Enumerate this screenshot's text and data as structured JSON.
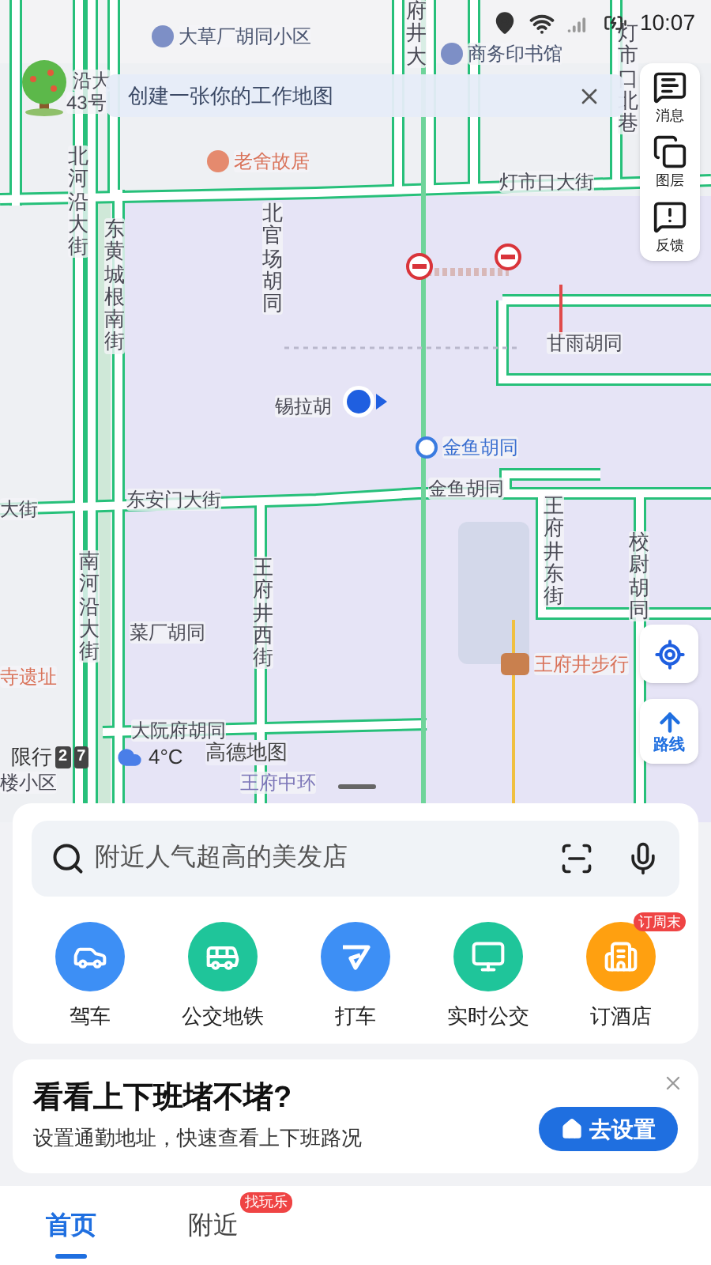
{
  "status_bar": {
    "time": "10:07"
  },
  "banner": {
    "text": "创建一张你的工作地图"
  },
  "map": {
    "labels": [
      {
        "text": "大草厂胡同小区",
        "kind": "poi",
        "vertical": false
      },
      {
        "text": "府井大",
        "kind": "road",
        "vertical": true
      },
      {
        "text": "商务印书馆",
        "kind": "poi",
        "vertical": false
      },
      {
        "text": "沿大",
        "kind": "road",
        "vertical": false
      },
      {
        "text": "43号",
        "kind": "road",
        "vertical": false
      },
      {
        "text": "灯市口北巷",
        "kind": "road",
        "vertical": true
      },
      {
        "text": "老舍故居",
        "kind": "sight",
        "vertical": false
      },
      {
        "text": "灯市口大街",
        "kind": "road",
        "vertical": false
      },
      {
        "text": "北河沿大街",
        "kind": "road",
        "vertical": true
      },
      {
        "text": "东黄城根南街",
        "kind": "road",
        "vertical": true
      },
      {
        "text": "北官场胡同",
        "kind": "road",
        "vertical": true
      },
      {
        "text": "甘雨胡同",
        "kind": "road",
        "vertical": false
      },
      {
        "text": "锡拉胡",
        "kind": "road",
        "vertical": false
      },
      {
        "text": "金鱼胡同",
        "kind": "metro",
        "vertical": false
      },
      {
        "text": "金鱼胡同",
        "kind": "road",
        "vertical": false
      },
      {
        "text": "大街",
        "kind": "road",
        "vertical": false
      },
      {
        "text": "东安门大街",
        "kind": "road",
        "vertical": false
      },
      {
        "text": "王府井东街",
        "kind": "road",
        "vertical": true
      },
      {
        "text": "校尉胡同",
        "kind": "road",
        "vertical": true
      },
      {
        "text": "南河沿大街",
        "kind": "road",
        "vertical": true
      },
      {
        "text": "王府井西街",
        "kind": "road",
        "vertical": true
      },
      {
        "text": "菜厂胡同",
        "kind": "road",
        "vertical": false
      },
      {
        "text": "王府井步行",
        "kind": "mall",
        "vertical": false
      },
      {
        "text": "寺遗址",
        "kind": "sight_text",
        "vertical": false
      },
      {
        "text": "大阮府胡同",
        "kind": "road",
        "vertical": false
      },
      {
        "text": "王府中环",
        "kind": "faint",
        "vertical": false
      },
      {
        "text": "楼小区",
        "kind": "road",
        "vertical": false
      }
    ],
    "restriction": {
      "label": "限行",
      "plates": [
        "2",
        "7"
      ]
    },
    "weather": {
      "temperature": "4°C"
    },
    "logo": "高德地图"
  },
  "side_tools": [
    {
      "label": "消息",
      "kind": "message"
    },
    {
      "label": "图层",
      "kind": "layers"
    },
    {
      "label": "反馈",
      "kind": "feedback"
    }
  ],
  "route_button": {
    "label": "路线"
  },
  "search": {
    "placeholder": "附近人气超高的美发店"
  },
  "quick_actions": [
    {
      "label": "驾车",
      "kind": "car",
      "color": "#3d8ff5"
    },
    {
      "label": "公交地铁",
      "kind": "bus",
      "color": "#1fc59a"
    },
    {
      "label": "打车",
      "kind": "taxi",
      "color": "#3d8ff5"
    },
    {
      "label": "实时公交",
      "kind": "realtime",
      "color": "#1fc59a"
    },
    {
      "label": "订酒店",
      "kind": "hotel",
      "color": "#ffa010",
      "badge": "订周末"
    }
  ],
  "commute_card": {
    "title": "看看上下班堵不堵?",
    "subtitle": "设置通勤地址，快速查看上下班路况",
    "button": "去设置"
  },
  "bottom_nav": [
    {
      "label": "首页",
      "selected": true
    },
    {
      "label": "附近",
      "selected": false,
      "badge": "找玩乐"
    }
  ]
}
